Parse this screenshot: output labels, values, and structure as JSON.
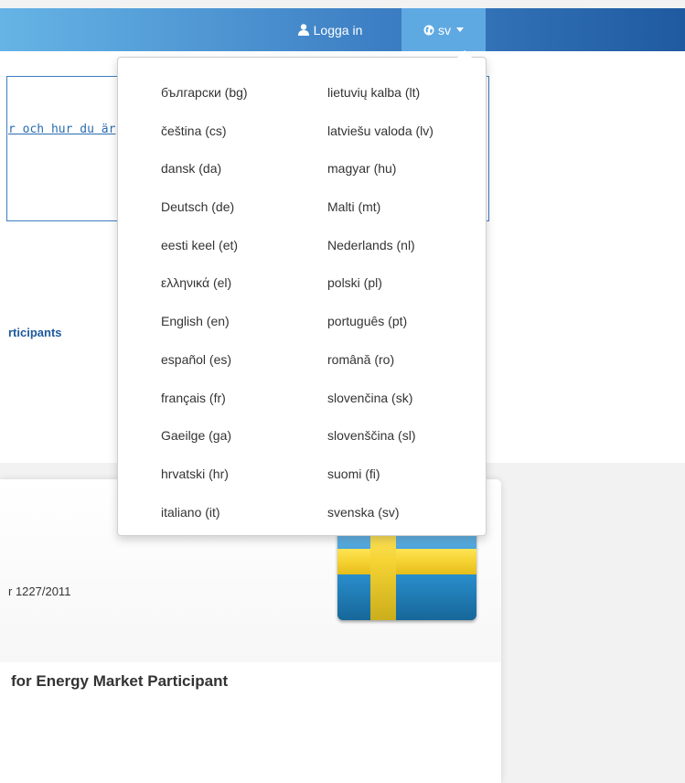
{
  "navbar": {
    "login_label": "Logga in",
    "lang_label": "sv",
    "colors": {
      "accent": "#3d7fc4",
      "active_tab": "#5fa9e3"
    }
  },
  "background": {
    "notice_link": "r och hur du är",
    "participants_link": "rticipants",
    "reg_text": "r 1227/2011",
    "heading": "for Energy Market Participant"
  },
  "languages": {
    "left": [
      "български (bg)",
      "čeština (cs)",
      "dansk (da)",
      "Deutsch (de)",
      "eesti keel (et)",
      "ελληνικά (el)",
      "English (en)",
      "español (es)",
      "français (fr)",
      "Gaeilge (ga)",
      "hrvatski (hr)",
      "italiano (it)"
    ],
    "right": [
      "lietuvių kalba (lt)",
      "latviešu valoda (lv)",
      "magyar (hu)",
      "Malti (mt)",
      "Nederlands (nl)",
      "polski (pl)",
      "português (pt)",
      "română (ro)",
      "slovenčina (sk)",
      "slovenščina (sl)",
      "suomi (fi)",
      "svenska (sv)"
    ]
  }
}
